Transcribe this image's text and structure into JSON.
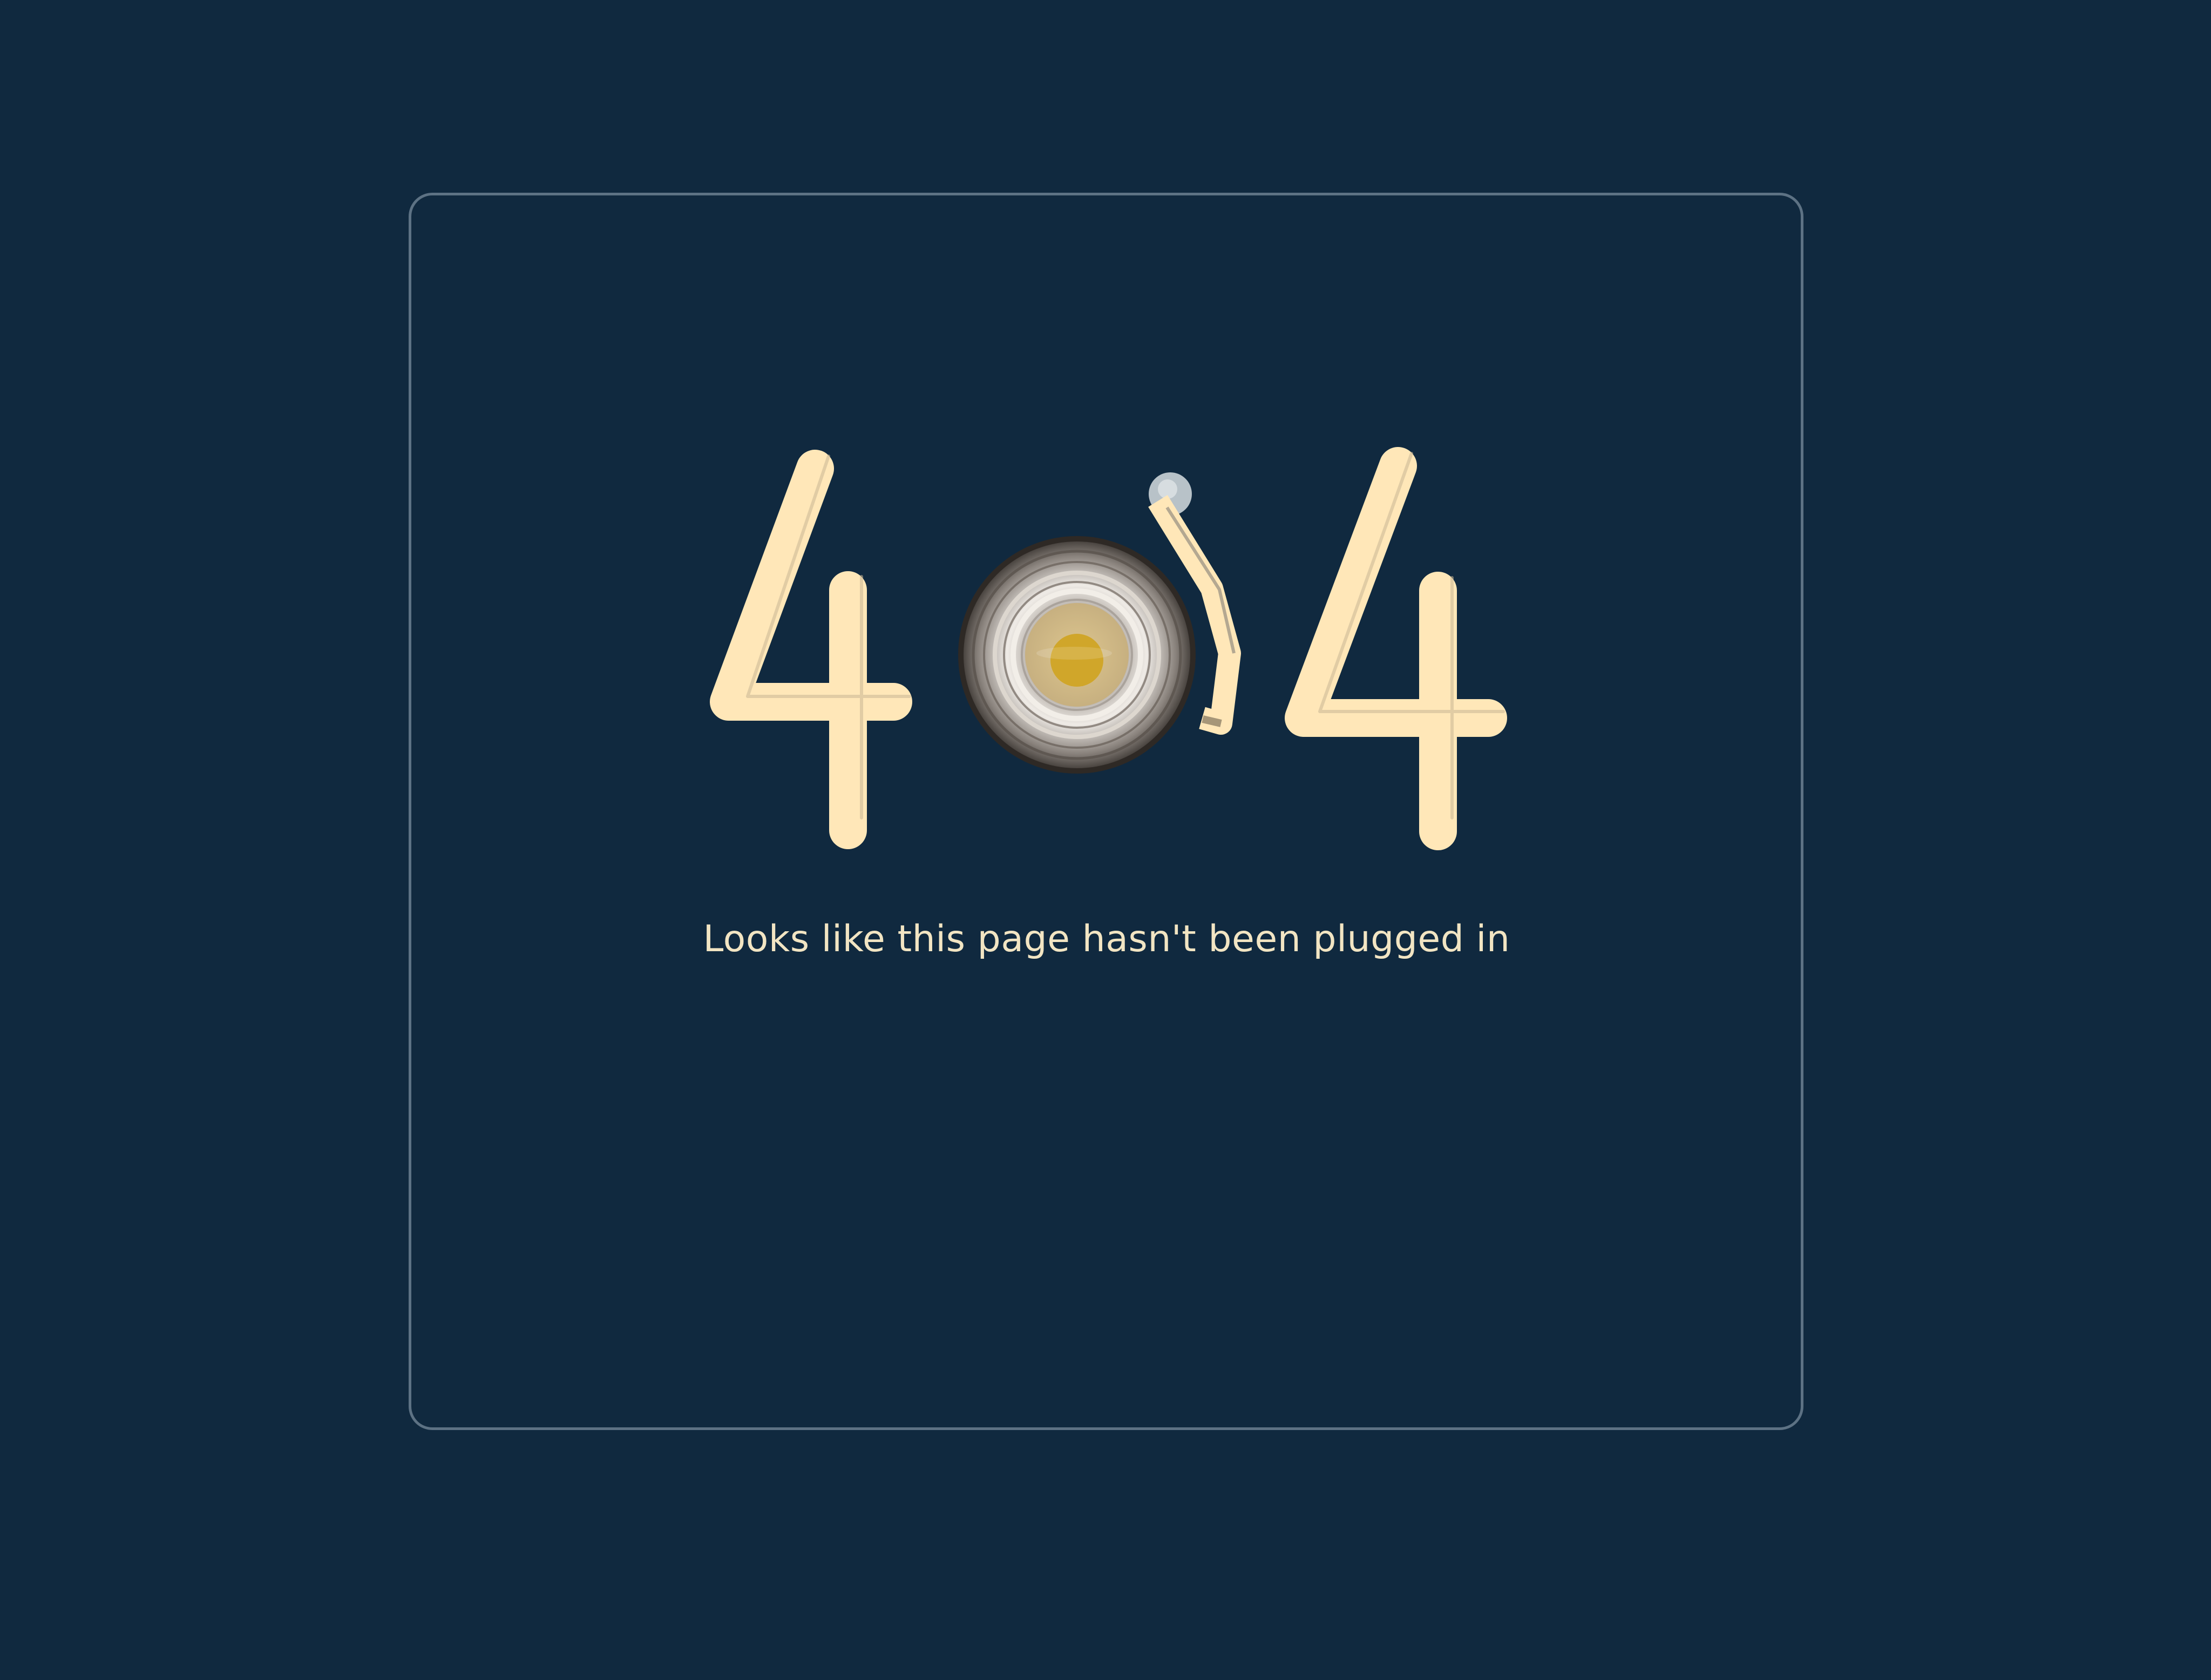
{
  "error": {
    "code_left_digit": "4",
    "code_right_digit": "4",
    "message": "Looks like this page hasn't been plugged in"
  },
  "icons": {
    "record": "vinyl-record-icon",
    "tonearm": "turntable-tonearm-icon"
  },
  "colors": {
    "background": "#10293f",
    "card_border": "#5d7284",
    "digit_fill": "#ffe7b8",
    "message_text": "#f2e5c3",
    "record_label": "#cfb788",
    "record_center": "#d0a62a",
    "tonearm_pivot": "#b8c2c8"
  }
}
